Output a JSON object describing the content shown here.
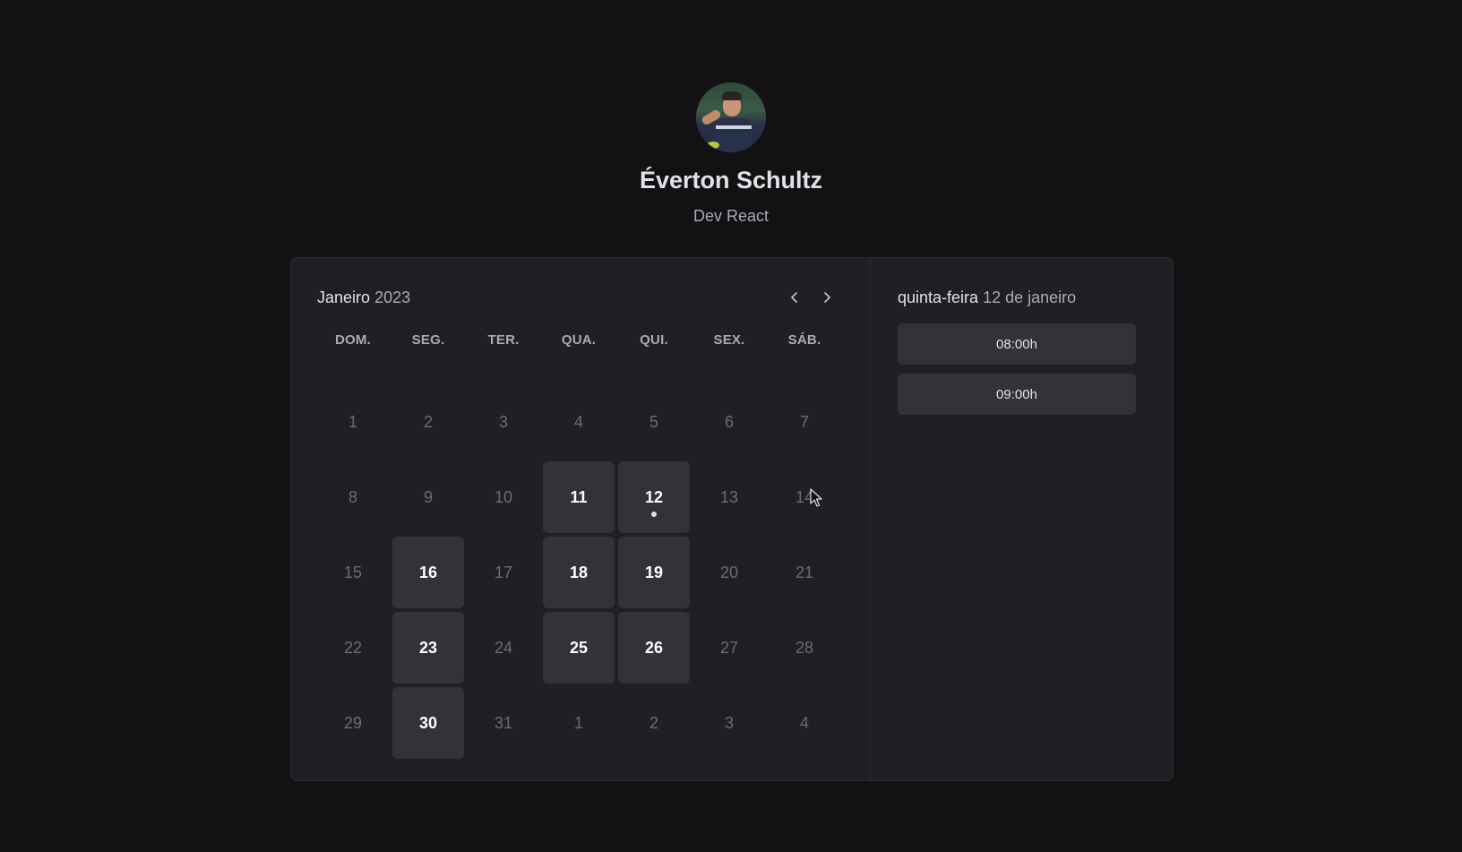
{
  "profile": {
    "name": "Éverton Schultz",
    "role": "Dev React"
  },
  "calendar": {
    "month": "Janeiro",
    "year": "2023",
    "weekdays": [
      "DOM.",
      "SEG.",
      "TER.",
      "QUA.",
      "QUI.",
      "SEX.",
      "SÁB."
    ],
    "weeks": [
      [
        {
          "d": "1",
          "a": false
        },
        {
          "d": "2",
          "a": false
        },
        {
          "d": "3",
          "a": false
        },
        {
          "d": "4",
          "a": false
        },
        {
          "d": "5",
          "a": false
        },
        {
          "d": "6",
          "a": false
        },
        {
          "d": "7",
          "a": false
        }
      ],
      [
        {
          "d": "8",
          "a": false
        },
        {
          "d": "9",
          "a": false
        },
        {
          "d": "10",
          "a": false
        },
        {
          "d": "11",
          "a": true
        },
        {
          "d": "12",
          "a": true,
          "selected": true
        },
        {
          "d": "13",
          "a": false
        },
        {
          "d": "14",
          "a": false
        }
      ],
      [
        {
          "d": "15",
          "a": false
        },
        {
          "d": "16",
          "a": true
        },
        {
          "d": "17",
          "a": false
        },
        {
          "d": "18",
          "a": true
        },
        {
          "d": "19",
          "a": true
        },
        {
          "d": "20",
          "a": false
        },
        {
          "d": "21",
          "a": false
        }
      ],
      [
        {
          "d": "22",
          "a": false
        },
        {
          "d": "23",
          "a": true
        },
        {
          "d": "24",
          "a": false
        },
        {
          "d": "25",
          "a": true
        },
        {
          "d": "26",
          "a": true
        },
        {
          "d": "27",
          "a": false
        },
        {
          "d": "28",
          "a": false
        }
      ],
      [
        {
          "d": "29",
          "a": false
        },
        {
          "d": "30",
          "a": true
        },
        {
          "d": "31",
          "a": false
        },
        {
          "d": "1",
          "a": false
        },
        {
          "d": "2",
          "a": false
        },
        {
          "d": "3",
          "a": false
        },
        {
          "d": "4",
          "a": false
        }
      ]
    ]
  },
  "schedule": {
    "weekday": "quinta-feira",
    "date": "12 de janeiro",
    "slots": [
      "08:00h",
      "09:00h"
    ]
  }
}
